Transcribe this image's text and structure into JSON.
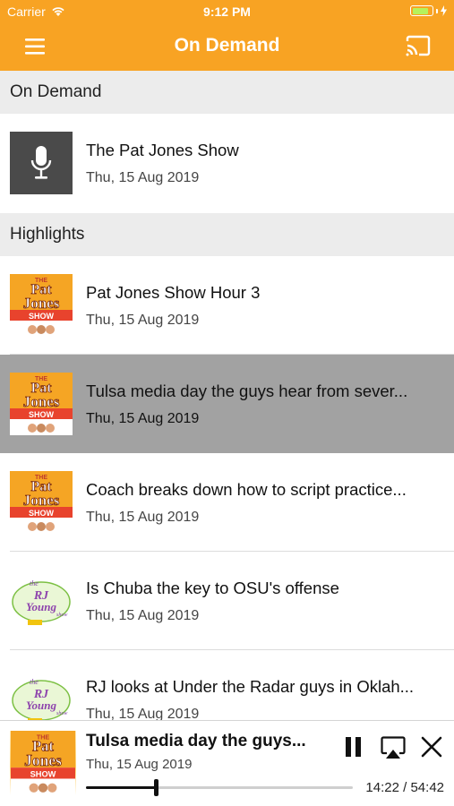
{
  "status_bar": {
    "carrier": "Carrier",
    "time": "9:12 PM",
    "battery_level": 0.85,
    "battery_color": "#b6f25b"
  },
  "nav": {
    "title": "On Demand",
    "menu_icon": "hamburger-menu-icon",
    "cast_icon": "cast-icon",
    "bar_color": "#f8a323"
  },
  "sections": [
    {
      "header": "On Demand",
      "items": [
        {
          "title": "The Pat Jones Show",
          "date": "Thu, 15 Aug 2019",
          "thumb": "microphone-icon",
          "selected": false
        }
      ]
    },
    {
      "header": "Highlights",
      "items": [
        {
          "title": "Pat Jones Show Hour 3",
          "date": "Thu, 15 Aug 2019",
          "thumb": "pat-jones-show-logo",
          "selected": false
        },
        {
          "title": "Tulsa media day the guys hear from sever...",
          "date": "Thu, 15 Aug 2019",
          "thumb": "pat-jones-show-logo",
          "selected": true
        },
        {
          "title": "Coach breaks down how to script practice...",
          "date": "Thu, 15 Aug 2019",
          "thumb": "pat-jones-show-logo",
          "selected": false
        },
        {
          "title": "Is Chuba the key to OSU's offense",
          "date": "Thu, 15 Aug 2019",
          "thumb": "rj-young-show-logo",
          "selected": false
        },
        {
          "title": "RJ looks at Under the Radar guys in Oklah...",
          "date": "Thu, 15 Aug 2019",
          "thumb": "rj-young-show-logo",
          "selected": false
        }
      ]
    }
  ],
  "logos": {
    "pat_jones": {
      "top": "THE",
      "name1": "Pat",
      "name2": "Jones",
      "show": "SHOW"
    },
    "rj_young": {
      "top": "the",
      "name1": "RJ",
      "name2": "Young",
      "show": "show"
    }
  },
  "player": {
    "title": "Tulsa media day the guys...",
    "date": "Thu, 15 Aug 2019",
    "elapsed": "14:22",
    "duration": "54:42",
    "time_display": "14:22 / 54:42",
    "progress": 0.263,
    "pause_icon": "pause-icon",
    "airplay_icon": "airplay-icon",
    "close_icon": "close-icon"
  }
}
